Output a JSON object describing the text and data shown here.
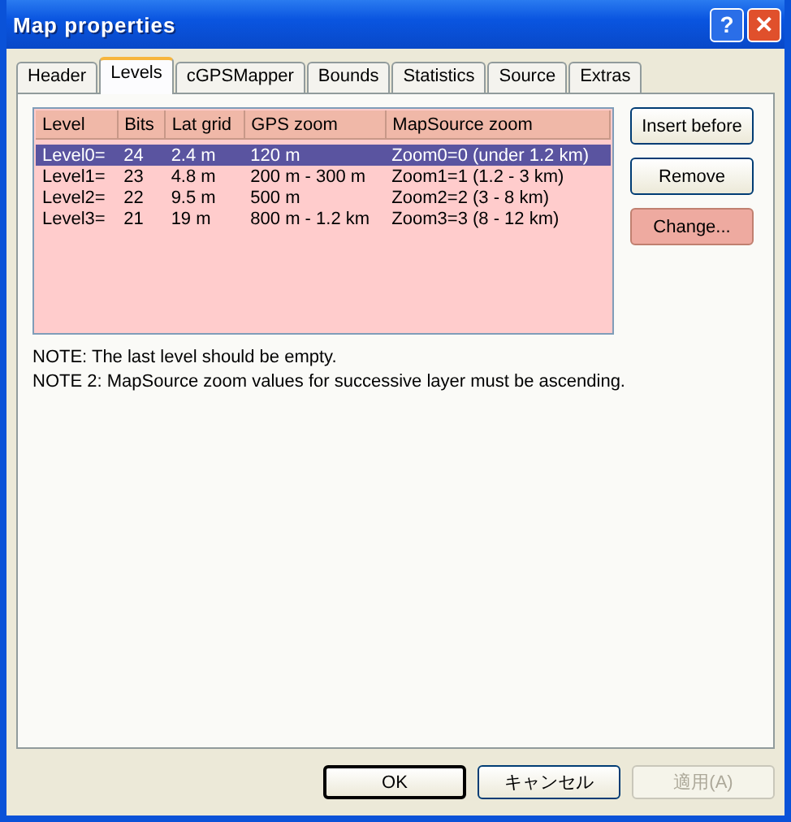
{
  "window": {
    "title": "Map properties",
    "title_buttons": [
      {
        "kind": "help",
        "label": "?"
      },
      {
        "kind": "close",
        "label": "✕"
      }
    ]
  },
  "tabs": [
    {
      "label": "Header",
      "selected": false
    },
    {
      "label": "Levels",
      "selected": true
    },
    {
      "label": "cGPSMapper",
      "selected": false
    },
    {
      "label": "Bounds",
      "selected": false
    },
    {
      "label": "Statistics",
      "selected": false
    },
    {
      "label": "Source",
      "selected": false
    },
    {
      "label": "Extras",
      "selected": false
    }
  ],
  "table": {
    "columns": [
      "Level",
      "Bits",
      "Lat grid",
      "GPS zoom",
      "MapSource zoom"
    ],
    "rows": [
      {
        "cells": [
          "Level0=",
          "24",
          "2.4 m",
          "120 m",
          "Zoom0=0 (under 1.2 km)"
        ],
        "selected": true
      },
      {
        "cells": [
          "Level1=",
          "23",
          "4.8 m",
          "200 m - 300 m",
          "Zoom1=1 (1.2 - 3 km)"
        ],
        "selected": false
      },
      {
        "cells": [
          "Level2=",
          "22",
          "9.5 m",
          "500 m",
          "Zoom2=2 (3 - 8 km)"
        ],
        "selected": false
      },
      {
        "cells": [
          "Level3=",
          "21",
          "19 m",
          "800 m - 1.2 km",
          "Zoom3=3 (8 - 12 km)"
        ],
        "selected": false
      }
    ]
  },
  "side_buttons": [
    {
      "label": "Insert before",
      "highlighted": false
    },
    {
      "label": "Remove",
      "highlighted": false
    },
    {
      "label": "Change...",
      "highlighted": true
    }
  ],
  "notes": [
    "NOTE: The last level should be empty.",
    "NOTE 2: MapSource zoom values for successive layer must be ascending."
  ],
  "dialog_buttons": [
    {
      "label": "OK",
      "default": true,
      "disabled": false
    },
    {
      "label": "キャンセル",
      "default": false,
      "disabled": false
    },
    {
      "label": "適用(A)",
      "default": false,
      "disabled": true
    }
  ]
}
